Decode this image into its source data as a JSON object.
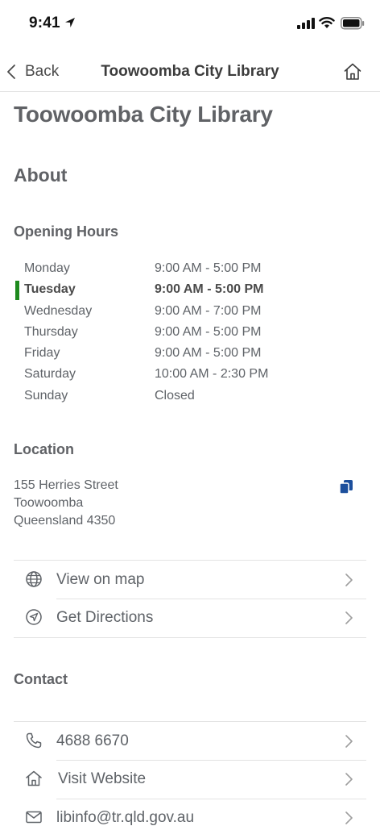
{
  "status": {
    "time": "9:41"
  },
  "nav": {
    "back_label": "Back",
    "title": "Toowoomba City Library"
  },
  "page": {
    "title": "Toowoomba City Library",
    "about": "About"
  },
  "hours": {
    "heading": "Opening Hours",
    "rows": [
      {
        "day": "Monday",
        "time": "9:00 AM - 5:00 PM"
      },
      {
        "day": "Tuesday",
        "time": "9:00 AM - 5:00 PM"
      },
      {
        "day": "Wednesday",
        "time": "9:00 AM - 7:00 PM"
      },
      {
        "day": "Thursday",
        "time": "9:00 AM - 5:00 PM"
      },
      {
        "day": "Friday",
        "time": "9:00 AM - 5:00 PM"
      },
      {
        "day": "Saturday",
        "time": "10:00 AM - 2:30 PM"
      },
      {
        "day": "Sunday",
        "time": "Closed"
      }
    ]
  },
  "location": {
    "heading": "Location",
    "address": [
      "155 Herries Street",
      "Toowoomba",
      "Queensland 4350"
    ],
    "actions": [
      {
        "label": "View on map",
        "icon": "globe-icon"
      },
      {
        "label": "Get Directions",
        "icon": "navigation-icon"
      }
    ]
  },
  "contact": {
    "heading": "Contact",
    "items": [
      {
        "label": "4688 6670",
        "icon": "phone-icon"
      },
      {
        "label": "Visit Website",
        "icon": "home-icon"
      },
      {
        "label": "libinfo@tr.qld.gov.au",
        "icon": "mail-icon"
      }
    ]
  },
  "colors": {
    "today_marker": "#1e8a1e",
    "copy_icon": "#1c4f9c",
    "text": "#5f6368"
  }
}
